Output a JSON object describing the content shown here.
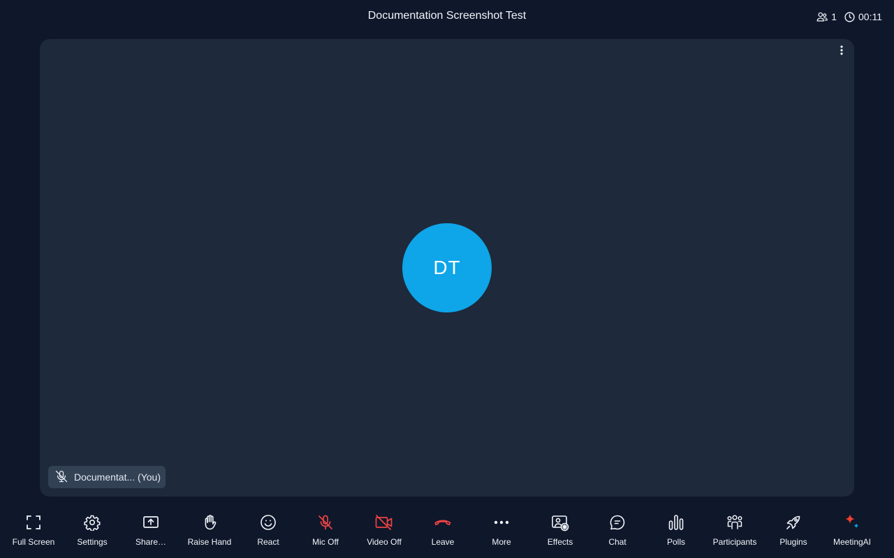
{
  "header": {
    "title": "Documentation Screenshot Test",
    "participant_count": "1",
    "elapsed_time": "00:11"
  },
  "stage": {
    "avatar_initials": "DT",
    "name_tag": "Documentat... (You)",
    "avatar_color": "#0ea5e9"
  },
  "toolbar": {
    "items": [
      {
        "label": "Full Screen",
        "icon": "fullscreen-icon"
      },
      {
        "label": "Settings",
        "icon": "gear-icon"
      },
      {
        "label": "Share…",
        "icon": "share-screen-icon"
      },
      {
        "label": "Raise Hand",
        "icon": "hand-icon"
      },
      {
        "label": "React",
        "icon": "smiley-icon"
      },
      {
        "label": "Mic Off",
        "icon": "mic-off-icon"
      },
      {
        "label": "Video Off",
        "icon": "video-off-icon"
      },
      {
        "label": "Leave",
        "icon": "phone-hangup-icon"
      },
      {
        "label": "More",
        "icon": "more-dots-icon"
      },
      {
        "label": "Effects",
        "icon": "effects-icon"
      },
      {
        "label": "Chat",
        "icon": "chat-bubble-icon"
      },
      {
        "label": "Polls",
        "icon": "polls-chart-icon"
      },
      {
        "label": "Participants",
        "icon": "participants-icon"
      },
      {
        "label": "Plugins",
        "icon": "rocket-icon"
      },
      {
        "label": "MeetingAI",
        "icon": "sparkle-icon"
      }
    ]
  },
  "colors": {
    "background": "#0f172a",
    "stage": "#1e293b",
    "danger": "#ef4444",
    "accent": "#0ea5e9"
  }
}
